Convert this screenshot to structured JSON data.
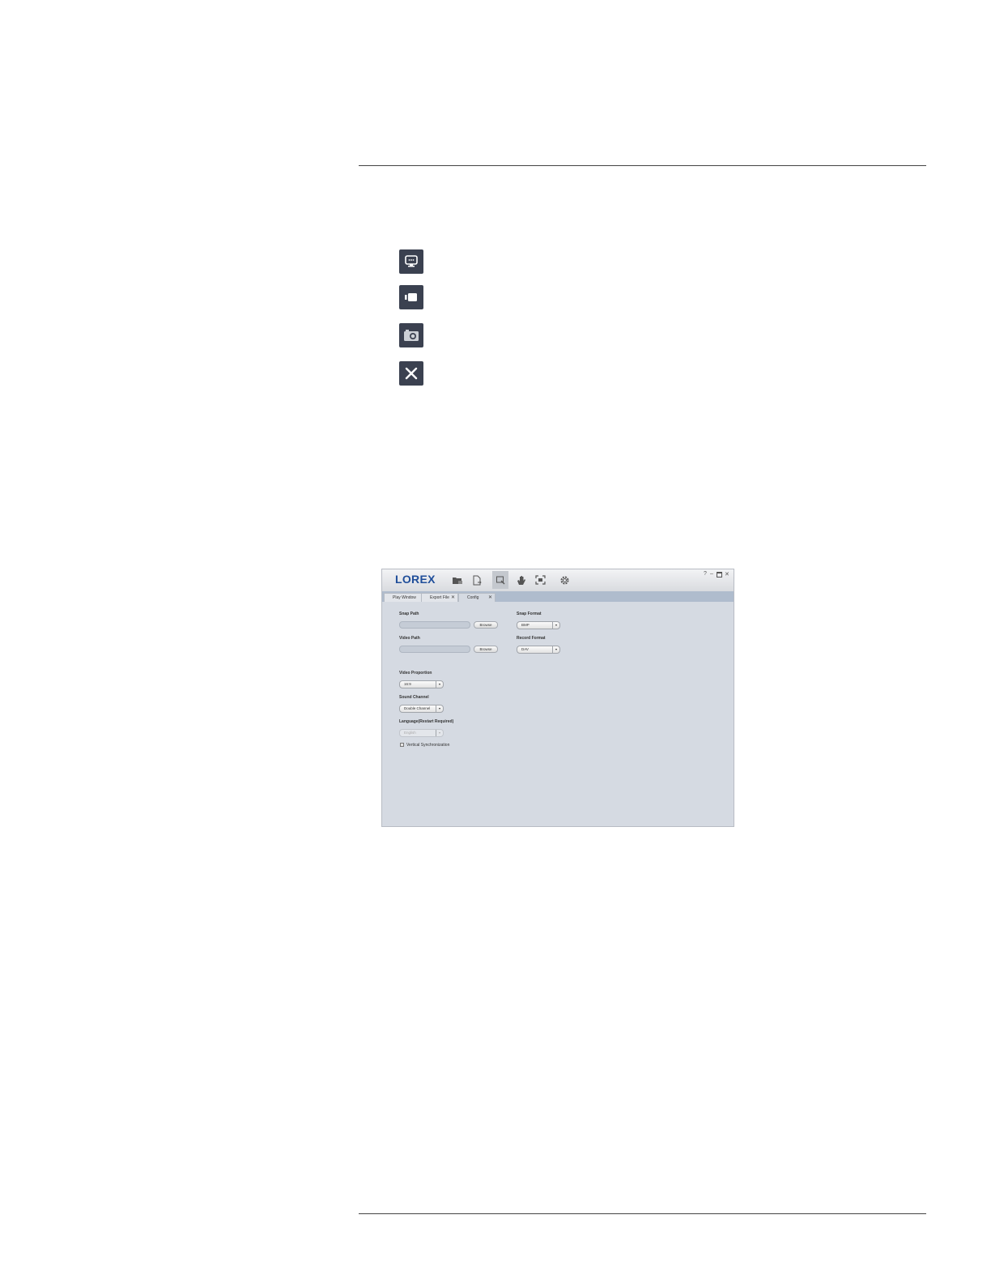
{
  "app": {
    "logo": "LOREX",
    "help": "?",
    "minimize": "–",
    "close": "✕",
    "tabs": [
      {
        "label": "Play Window"
      },
      {
        "label": "Export File",
        "close": "✕"
      },
      {
        "label": "Config",
        "close": "✕"
      }
    ],
    "config": {
      "snap_path_label": "Snap Path",
      "snap_path_value": "",
      "browse_1": "Browse",
      "video_path_label": "Video Path",
      "video_path_value": "",
      "browse_2": "Browse",
      "snap_format_label": "Snap Format",
      "snap_format_value": "BMP",
      "record_format_label": "Record Format",
      "record_format_value": "DAV",
      "video_proportion_label": "Video Proportion",
      "video_proportion_value": "16:9",
      "sound_channel_label": "Sound Channel",
      "sound_channel_value": "Double Channel",
      "language_label": "Language(Restart Required)",
      "language_value": "English",
      "vsync_label": "Vertical Synchronization",
      "dropdown_arrow": "▾"
    }
  },
  "colors": {
    "brand": "#1f4e9a",
    "icon_tile": "#3b4150",
    "app_background": "#d5dae2",
    "tab_bar": "#afbccd"
  }
}
